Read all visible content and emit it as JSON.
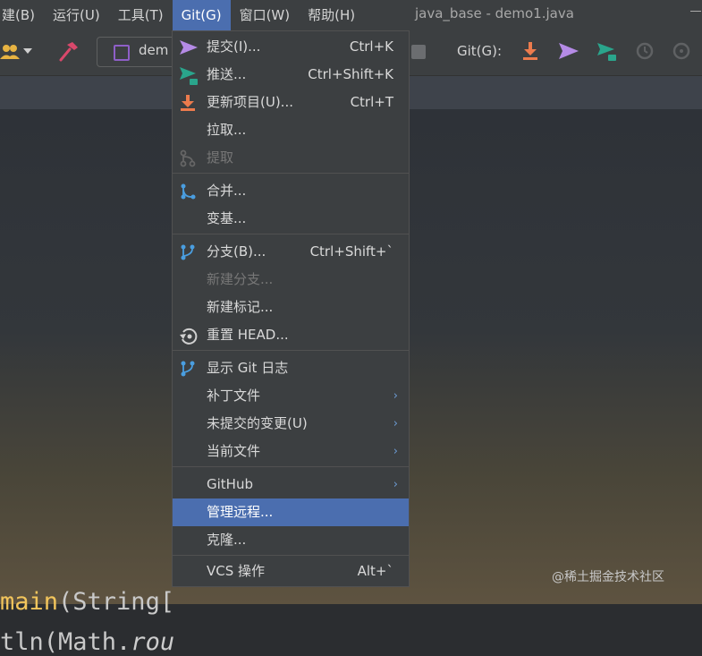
{
  "window_title": "java_base - demo1.java",
  "menubar": {
    "items": [
      "建(B)",
      "运行(U)",
      "工具(T)",
      "Git(G)",
      "窗口(W)",
      "帮助(H)"
    ]
  },
  "toolbar": {
    "run_config_label": "dem",
    "git_label": "Git(G):"
  },
  "code": {
    "line1_method": "main",
    "line1_rest": "(String[",
    "line2_prefix": "tln(Math.",
    "line2_italic": "rou"
  },
  "git_menu": {
    "items": [
      {
        "label": "提交(I)...",
        "shortcut": "Ctrl+K",
        "icon": "commit-arrow-icon"
      },
      {
        "label": "推送...",
        "shortcut": "Ctrl+Shift+K",
        "icon": "push-icon"
      },
      {
        "label": "更新项目(U)...",
        "shortcut": "Ctrl+T",
        "icon": "update-icon"
      },
      {
        "label": "拉取...",
        "shortcut": ""
      },
      {
        "label": "提取",
        "shortcut": "",
        "icon": "fetch-icon",
        "disabled": true
      },
      {
        "label": "合并...",
        "shortcut": "",
        "icon": "merge-icon"
      },
      {
        "label": "变基...",
        "shortcut": ""
      },
      {
        "label": "分支(B)...",
        "shortcut": "Ctrl+Shift+`",
        "icon": "branch-icon"
      },
      {
        "label": "新建分支...",
        "shortcut": "",
        "disabled": true
      },
      {
        "label": "新建标记...",
        "shortcut": ""
      },
      {
        "label": "重置 HEAD...",
        "shortcut": "",
        "icon": "reset-icon"
      },
      {
        "label": "显示 Git 日志",
        "shortcut": "",
        "icon": "branch-icon"
      },
      {
        "label": "补丁文件",
        "submenu": true
      },
      {
        "label": "未提交的变更(U)",
        "submenu": true
      },
      {
        "label": "当前文件",
        "submenu": true
      },
      {
        "label": "GitHub",
        "submenu": true
      },
      {
        "label": "管理远程...",
        "highlight": true
      },
      {
        "label": "克隆..."
      },
      {
        "label": "VCS 操作",
        "shortcut": "Alt+`"
      }
    ]
  },
  "watermark": "@稀土掘金技术社区",
  "colors": {
    "accent": "#4b6eaf",
    "commit": "#b58be6",
    "push": "#2aa58c",
    "update": "#ec7b4d",
    "merge": "#4a9ee0"
  }
}
